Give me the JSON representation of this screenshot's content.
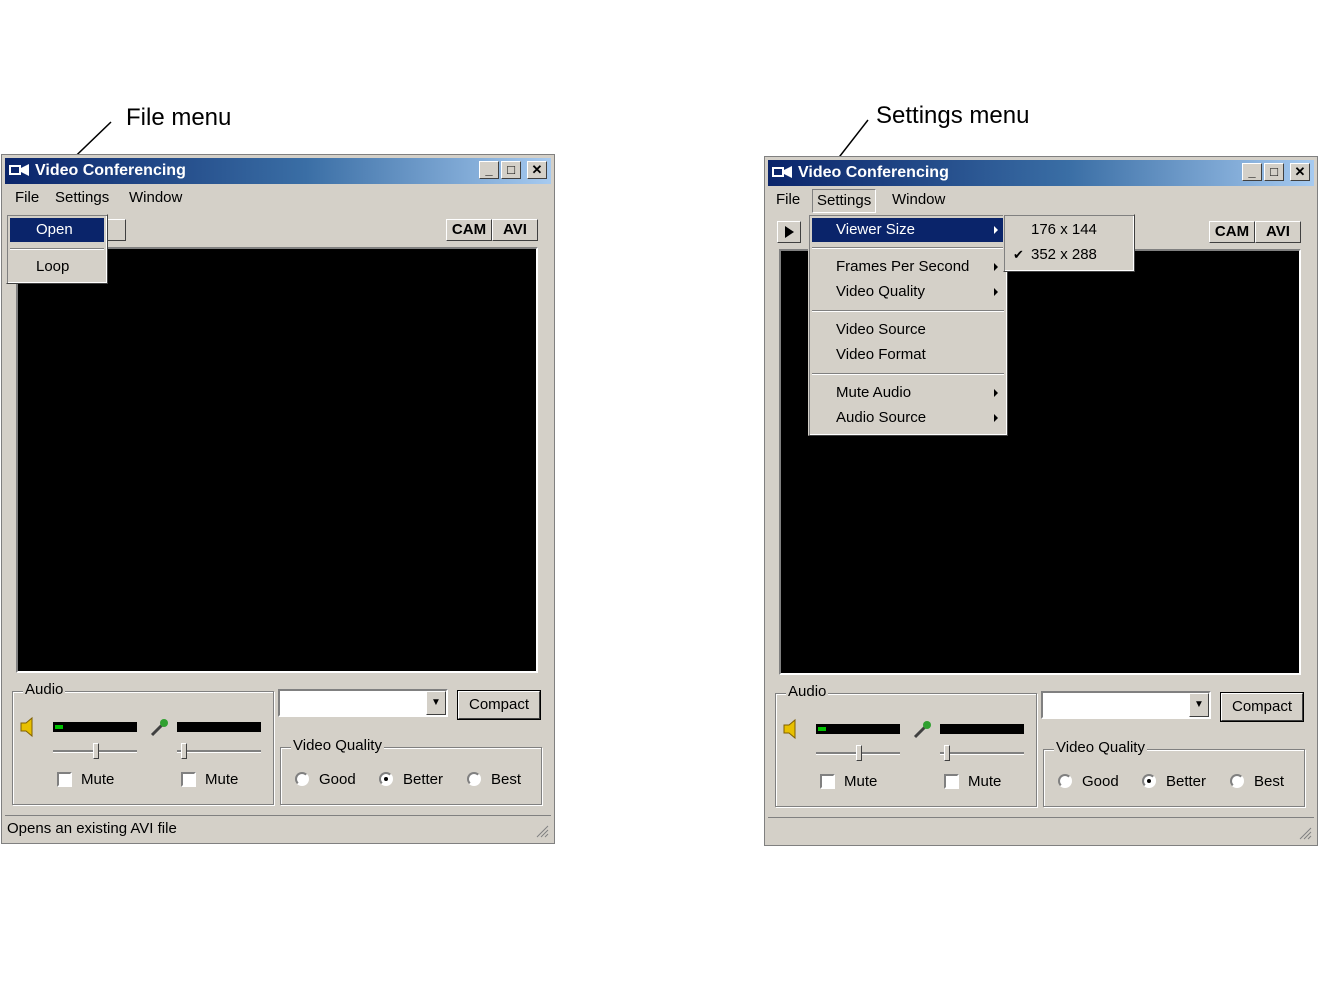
{
  "callouts": {
    "left": "File menu",
    "right": "Settings menu"
  },
  "window": {
    "title": "Video Conferencing",
    "controls": {
      "minimize": "_",
      "maximize": "□",
      "close": "✕"
    },
    "menubar": {
      "file": "File",
      "settings": "Settings",
      "window": "Window"
    },
    "toolbar": {
      "cam": "CAM",
      "avi": "AVI",
      "play_icon": "play-icon"
    },
    "audio": {
      "group_label": "Audio",
      "speaker_icon": "speaker-icon",
      "mic_icon": "microphone-icon",
      "mute_label": "Mute"
    },
    "source_combo": {
      "value": ""
    },
    "compact_button": "Compact",
    "video_quality": {
      "label": "Video Quality",
      "options": [
        "Good",
        "Better",
        "Best"
      ],
      "selected": "Better"
    }
  },
  "left_window": {
    "status_text": "Opens an existing AVI file",
    "file_menu": {
      "items": [
        "Open",
        "Loop"
      ],
      "highlighted": "Open"
    }
  },
  "right_window": {
    "status_text": "",
    "settings_menu": {
      "items": [
        "Viewer Size",
        "Frames Per Second",
        "Video Quality",
        "Video Source",
        "Video Format",
        "Mute Audio",
        "Audio Source"
      ],
      "highlighted": "Viewer Size"
    },
    "viewer_size_submenu": {
      "items": [
        "176 x 144",
        "352 x 288"
      ],
      "checked": "352 x 288"
    }
  }
}
